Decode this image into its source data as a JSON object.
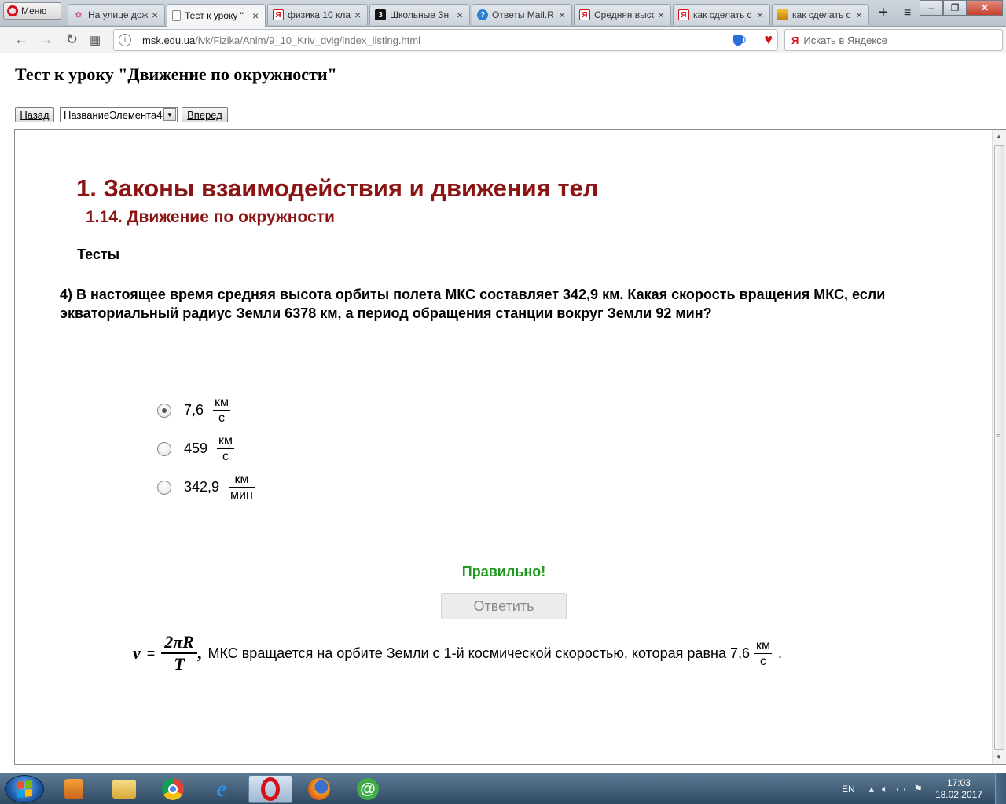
{
  "browser": {
    "menu_label": "Меню",
    "tabs": [
      {
        "title": "На улице дож",
        "favicon": "flamingo-icon",
        "active": false
      },
      {
        "title": "Тест к уроку \"",
        "favicon": "page-icon",
        "active": true
      },
      {
        "title": "физика 10 кла",
        "favicon": "yandex-icon",
        "active": false
      },
      {
        "title": "Школьные Зн",
        "favicon": "znanija-icon",
        "active": false
      },
      {
        "title": "Ответы Mail.R",
        "favicon": "question-icon",
        "active": false
      },
      {
        "title": "Средняя высо",
        "favicon": "yandex-icon",
        "active": false
      },
      {
        "title": "как сделать с",
        "favicon": "yandex-icon",
        "active": false
      },
      {
        "title": "как сделать с",
        "favicon": "image-icon",
        "active": false
      }
    ],
    "url_host": "msk.edu.ua",
    "url_path": "/ivk/Fizika/Anim/9_10_Kriv_dvig/index_listing.html",
    "badge_count": "0",
    "search_placeholder": "Искать в Яндексе",
    "search_logo": "Я"
  },
  "page": {
    "title": "Тест к уроку \"Движение по окружности\"",
    "nav": {
      "back_label": "Назад",
      "select_value": "НазваниеЭлемента4",
      "forward_label": "Вперед"
    },
    "chapter": "1. Законы взаимодействия и движения тел",
    "section": "1.14. Движение по окружности",
    "tests_heading": "Тесты",
    "question": "4) В настоящее время средняя высота орбиты полета МКС составляет 342,9 км. Какая скорость вращения МКС, если экваториальный радиус Земли 6378 км, а период обращения станции вокруг Земли 92 мин?",
    "options": [
      {
        "value": "7,6",
        "unit_num": "км",
        "unit_den": "с",
        "selected": true
      },
      {
        "value": "459",
        "unit_num": "км",
        "unit_den": "с",
        "selected": false
      },
      {
        "value": "342,9",
        "unit_num": "км",
        "unit_den": "мин",
        "selected": false
      }
    ],
    "feedback": "Правильно!",
    "answer_button": "Ответить",
    "explanation": {
      "var": "v",
      "eq": "=",
      "numerator": "2πR",
      "denominator": "T",
      "comma": ",",
      "text": "МКС вращается на орбите Земли с 1-й космической скоростью, которая равна 7,6",
      "unit_num": "км",
      "unit_den": "с",
      "end": "."
    }
  },
  "taskbar": {
    "lang": "EN",
    "time": "17:03",
    "date": "18.02.2017",
    "apps": [
      "media-player-icon",
      "file-explorer-icon",
      "chrome-icon",
      "internet-explorer-icon",
      "opera-icon",
      "firefox-icon",
      "icq-icon"
    ],
    "active_app": "opera-icon"
  },
  "colors": {
    "heading_red": "#8b1414",
    "correct_green": "#1f9a1f",
    "opera_red": "#d5101b"
  }
}
